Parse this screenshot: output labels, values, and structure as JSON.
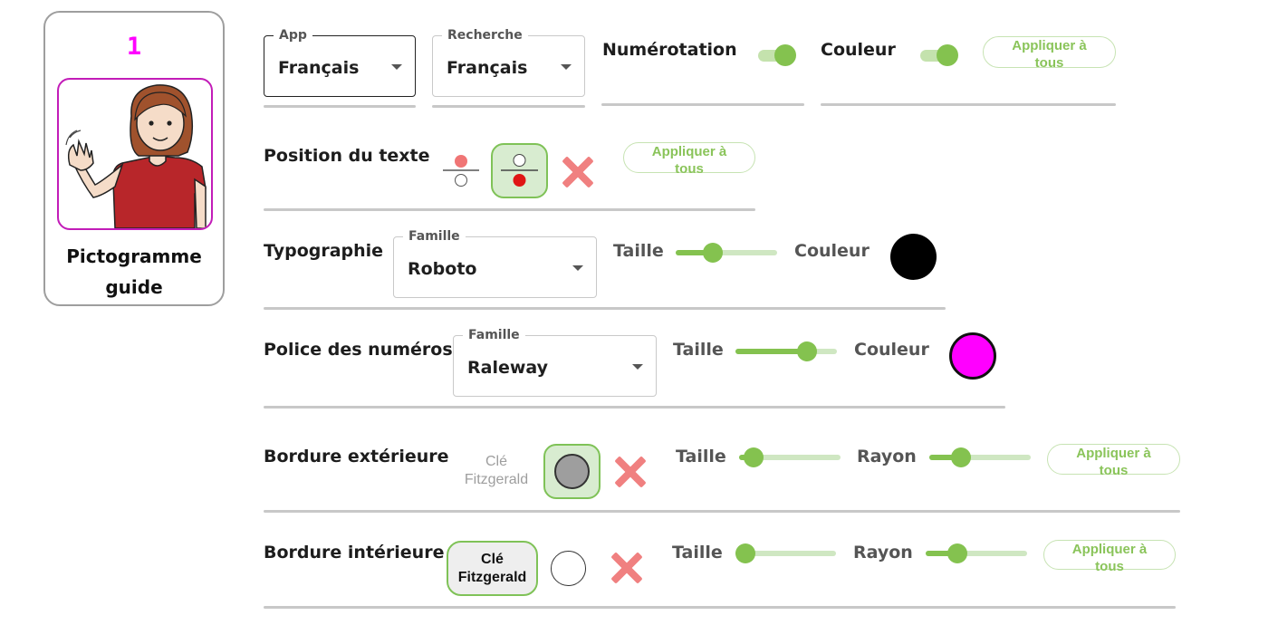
{
  "card": {
    "number": "1",
    "title_line1": "Pictogramme",
    "title_line2": "guide"
  },
  "header": {
    "app_select": {
      "legend": "App",
      "value": "Français"
    },
    "search_select": {
      "legend": "Recherche",
      "value": "Français"
    },
    "numbering": {
      "label": "Numérotation",
      "enabled": true
    },
    "color": {
      "label": "Couleur",
      "enabled": true
    },
    "apply_line1": "Appliquer à",
    "apply_line2": "tous"
  },
  "text_position": {
    "label": "Position du texte",
    "options": [
      "text-above",
      "text-below"
    ],
    "selected": "text-below",
    "apply_line1": "Appliquer à",
    "apply_line2": "tous"
  },
  "typography": {
    "label": "Typographie",
    "family_legend": "Famille",
    "family_value": "Roboto",
    "size_label": "Taille",
    "size_level": 0.33,
    "color_label": "Couleur",
    "color_value": "#000000"
  },
  "number_font": {
    "label": "Police des numéros",
    "family_legend": "Famille",
    "family_value": "Raleway",
    "size_label": "Taille",
    "size_level": 0.75,
    "color_label": "Couleur",
    "color_value": "#ff00ff"
  },
  "outer_border": {
    "label": "Bordure extérieure",
    "fitz_line1": "Clé",
    "fitz_line2": "Fitzgerald",
    "swatch_color": "#9e9e9e",
    "size_label": "Taille",
    "size_level": 0.05,
    "radius_label": "Rayon",
    "radius_level": 0.27,
    "apply_line1": "Appliquer à",
    "apply_line2": "tous"
  },
  "inner_border": {
    "label": "Bordure intérieure",
    "fitz_line1": "Clé",
    "fitz_line2": "Fitzgerald",
    "swatch_color": "#ffffff",
    "size_label": "Taille",
    "size_level": 0.0,
    "radius_label": "Rayon",
    "radius_level": 0.27,
    "apply_line1": "Appliquer à",
    "apply_line2": "tous"
  },
  "colors": {
    "accent": "#84c24f",
    "magenta": "#ff00ff",
    "remove": "#f08080"
  }
}
